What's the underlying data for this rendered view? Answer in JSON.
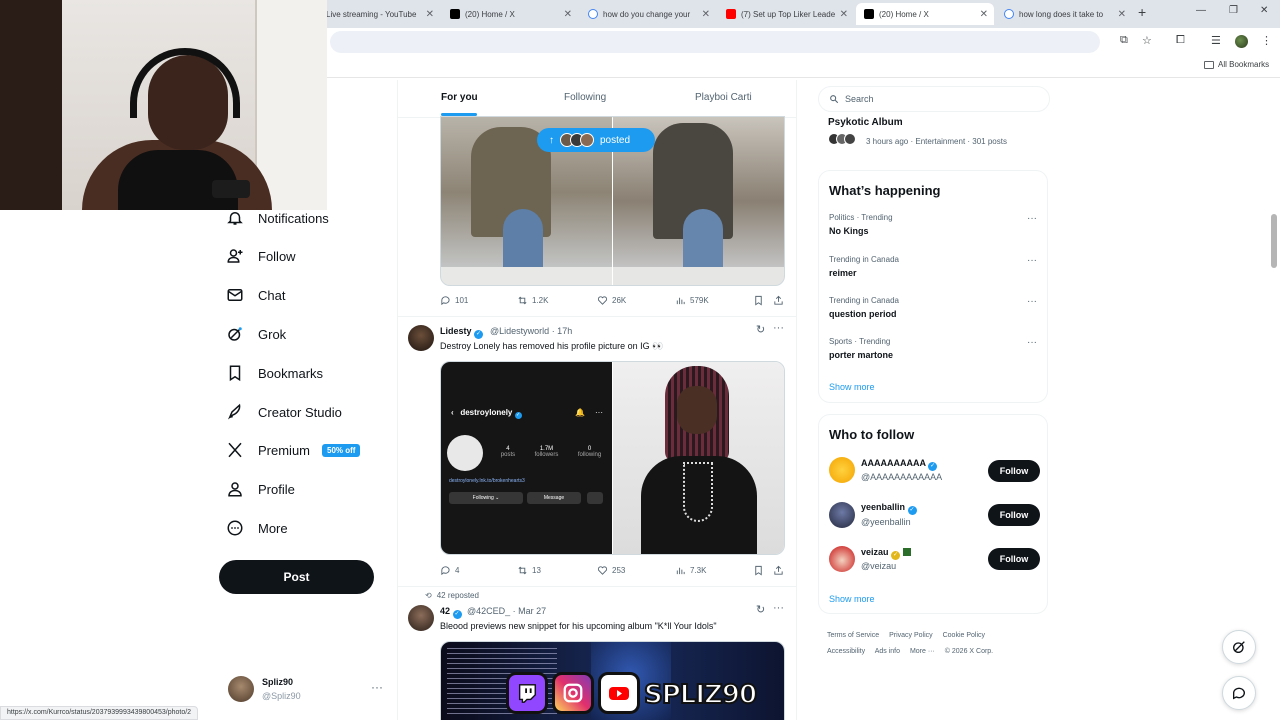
{
  "browser": {
    "tabs": [
      {
        "label": "Live streaming - YouTube",
        "active": false
      },
      {
        "label": "(20) Home / X",
        "active": false
      },
      {
        "label": "how do you change your",
        "active": false
      },
      {
        "label": "(7) Set up Top Liker Leade",
        "active": false
      },
      {
        "label": "(20) Home / X",
        "active": true
      },
      {
        "label": "how long does it take to",
        "active": false
      }
    ],
    "all_bookmarks": "All Bookmarks",
    "status_url": "https://x.com/Kurrco/status/2037939993439800453/photo/2"
  },
  "nav": {
    "items": [
      {
        "label": "Notifications",
        "icon": "bell-icon"
      },
      {
        "label": "Follow",
        "icon": "follow-icon"
      },
      {
        "label": "Chat",
        "icon": "chat-icon"
      },
      {
        "label": "Grok",
        "icon": "grok-icon"
      },
      {
        "label": "Bookmarks",
        "icon": "bookmark-icon"
      },
      {
        "label": "Creator Studio",
        "icon": "rocket-icon"
      },
      {
        "label": "Premium",
        "icon": "x-logo-icon",
        "badge": "50% off"
      },
      {
        "label": "Profile",
        "icon": "profile-icon"
      },
      {
        "label": "More",
        "icon": "more-circle-icon"
      }
    ],
    "post_label": "Post",
    "account": {
      "name": "Spliz90",
      "handle": "@Spliz90"
    }
  },
  "timeline": {
    "tabs": [
      "For you",
      "Following",
      "Playboi Carti"
    ],
    "posted_pill": "posted",
    "tweet1_actions": {
      "replies": "101",
      "reposts": "1.2K",
      "likes": "26K",
      "views": "579K"
    },
    "tweet2": {
      "name": "Lidesty",
      "handle": "@Lidestyworld",
      "time": "· 17h",
      "text": "Destroy Lonely has removed his profile picture on IG 👀",
      "profile_card": {
        "username": "destroylonely",
        "posts": "4",
        "posts_label": "posts",
        "followers": "1.7M",
        "followers_label": "followers",
        "following": "0",
        "following_label": "following",
        "link": "destroylonely.lnk.to/brokenhearts3",
        "btn_following": "Following ⌄",
        "btn_message": "Message"
      },
      "actions": {
        "replies": "4",
        "reposts": "13",
        "likes": "253",
        "views": "7.3K"
      }
    },
    "tweet3": {
      "repost_label": "42 reposted",
      "name": "42",
      "handle": "@42CED_",
      "time": "· Mar 27",
      "text": "Bleood previews new snippet for his upcoming album \"K*ll Your Idols\""
    }
  },
  "right": {
    "search_placeholder": "Search",
    "psykotic": {
      "title": "Psykotic Album",
      "meta": "3 hours ago · Entertainment · 301 posts"
    },
    "happening": {
      "title": "What’s happening",
      "trends": [
        {
          "meta": "Politics · Trending",
          "name": "No Kings"
        },
        {
          "meta": "Trending in Canada",
          "name": "reimer"
        },
        {
          "meta": "Trending in Canada",
          "name": "question period"
        },
        {
          "meta": "Sports · Trending",
          "name": "porter martone"
        }
      ],
      "show_more": "Show more"
    },
    "who_to_follow": {
      "title": "Who to follow",
      "users": [
        {
          "name": "AAAAAAAAAA",
          "handle": "@AAAAAAAAAAAA"
        },
        {
          "name": "yeenballin",
          "handle": "@yeenballin"
        },
        {
          "name": "veizau",
          "handle": "@veizau"
        }
      ],
      "follow_label": "Follow",
      "show_more": "Show more"
    },
    "footer": [
      "Terms of Service",
      "Privacy Policy",
      "Cookie Policy",
      "Accessibility",
      "Ads info",
      "More ···",
      "© 2026 X Corp."
    ]
  },
  "overlay": {
    "streamer": "SPLIZ90"
  }
}
